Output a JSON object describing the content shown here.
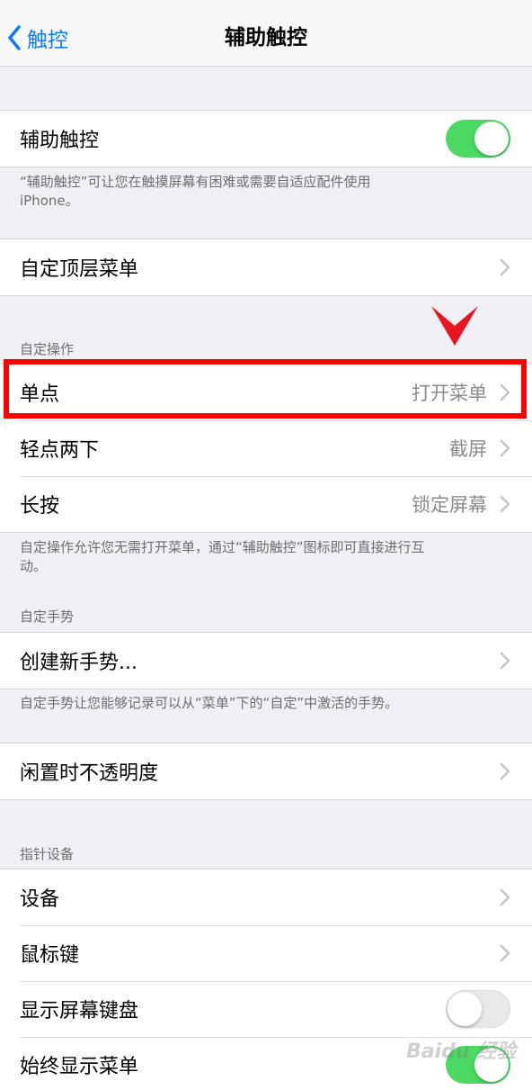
{
  "navbar": {
    "back_label": "触控",
    "title": "辅助触控"
  },
  "assistive_touch": {
    "label": "辅助触控",
    "enabled": true,
    "footer": "“辅助触控”可让您在触摸屏幕有困难或需要自适应配件使用 iPhone。"
  },
  "top_menu": {
    "label": "自定顶层菜单"
  },
  "custom_actions": {
    "header": "自定操作",
    "items": [
      {
        "label": "单点",
        "value": "打开菜单"
      },
      {
        "label": "轻点两下",
        "value": "截屏"
      },
      {
        "label": "长按",
        "value": "锁定屏幕"
      }
    ],
    "footer": "自定操作允许您无需打开菜单，通过“辅助触控”图标即可直接进行互动。"
  },
  "custom_gestures": {
    "header": "自定手势",
    "create_label": "创建新手势...",
    "footer": "自定手势让您能够记录可以从“菜单”下的“自定”中激活的手势。"
  },
  "idle_opacity": {
    "label": "闲置时不透明度"
  },
  "pointer_devices": {
    "header": "指针设备",
    "devices_label": "设备",
    "mouse_keys_label": "鼠标键",
    "show_keyboard_label": "显示屏幕键盘",
    "show_keyboard_enabled": false,
    "always_show_menu_label": "始终显示菜单",
    "always_show_menu_enabled": true
  },
  "annotation": {
    "highlight_color": "#ff0000"
  },
  "watermark": {
    "text": "Baidu 经验"
  },
  "colors": {
    "accent": "#0a7aff",
    "toggle_on": "#4cd964"
  }
}
